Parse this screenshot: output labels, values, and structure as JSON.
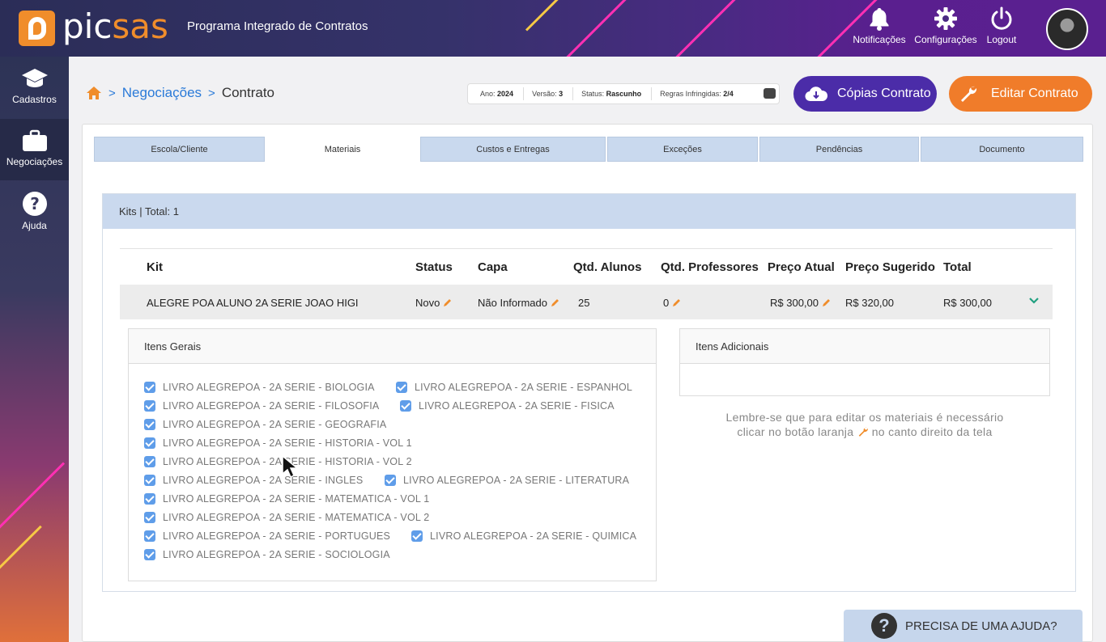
{
  "header": {
    "logo_pic": "pic",
    "logo_sas": "sas",
    "title": "Programa Integrado de Contratos",
    "notifications_label": "Notificações",
    "settings_label": "Configurações",
    "logout_label": "Logout"
  },
  "sidebar": {
    "items": [
      {
        "label": "Cadastros",
        "icon": "graduation-cap-icon"
      },
      {
        "label": "Negociações",
        "icon": "briefcase-icon"
      },
      {
        "label": "Ajuda",
        "icon": "question-circle-icon"
      }
    ]
  },
  "breadcrumb": {
    "link": "Negociações",
    "current": "Contrato"
  },
  "status": {
    "ano_label": "Ano:",
    "ano": "2024",
    "versao_label": "Versão:",
    "versao": "3",
    "status_label": "Status:",
    "status": "Rascunho",
    "regras_label": "Regras Infringidas:",
    "regras": "2/4"
  },
  "actions": {
    "copias": "Cópias Contrato",
    "editar": "Editar Contrato"
  },
  "tabs": [
    "Escola/Cliente",
    "Materiais",
    "Custos e Entregas",
    "Exceções",
    "Pendências",
    "Documento"
  ],
  "kits": {
    "header": "Kits | Total: 1",
    "columns": [
      "Kit",
      "Status",
      "Capa",
      "Qtd. Alunos",
      "Qtd. Professores",
      "Preço Atual",
      "Preço Sugerido",
      "Total"
    ],
    "row": {
      "kit": "ALEGRE POA ALUNO 2A SERIE JOAO HIGI",
      "status": "Novo",
      "capa": "Não Informado",
      "alunos": "25",
      "professores": "0",
      "preco_atual": "R$ 300,00",
      "preco_sugerido": "R$ 320,00",
      "total": "R$ 300,00"
    }
  },
  "itens_gerais": {
    "title": "Itens Gerais",
    "items": [
      "LIVRO ALEGREPOA - 2A SERIE - BIOLOGIA",
      "LIVRO ALEGREPOA - 2A SERIE - ESPANHOL",
      "LIVRO ALEGREPOA - 2A SERIE - FILOSOFIA",
      "LIVRO ALEGREPOA - 2A SERIE - FISICA",
      "LIVRO ALEGREPOA - 2A SERIE - GEOGRAFIA",
      "LIVRO ALEGREPOA - 2A SERIE - HISTORIA - VOL 1",
      "LIVRO ALEGREPOA - 2A SERIE - HISTORIA - VOL 2",
      "LIVRO ALEGREPOA - 2A SERIE - INGLES",
      "LIVRO ALEGREPOA - 2A SERIE - LITERATURA",
      "LIVRO ALEGREPOA - 2A SERIE - MATEMATICA - VOL 1",
      "LIVRO ALEGREPOA - 2A SERIE - MATEMATICA - VOL 2",
      "LIVRO ALEGREPOA - 2A SERIE - PORTUGUES",
      "LIVRO ALEGREPOA - 2A SERIE - QUIMICA",
      "LIVRO ALEGREPOA - 2A SERIE - SOCIOLOGIA"
    ]
  },
  "itens_adicionais": {
    "title": "Itens Adicionais"
  },
  "hint": {
    "line1": "Lembre-se que para editar os materiais é necessário",
    "line2_a": "clicar no botão laranja",
    "line2_b": "no canto direito da tela"
  },
  "help": {
    "label": "PRECISA DE UMA AJUDA?"
  },
  "colors": {
    "accent_orange": "#f07c2a",
    "accent_purple": "#4b2ca8",
    "link_blue": "#2a7ad8",
    "checkbox": "#5f9de9"
  }
}
